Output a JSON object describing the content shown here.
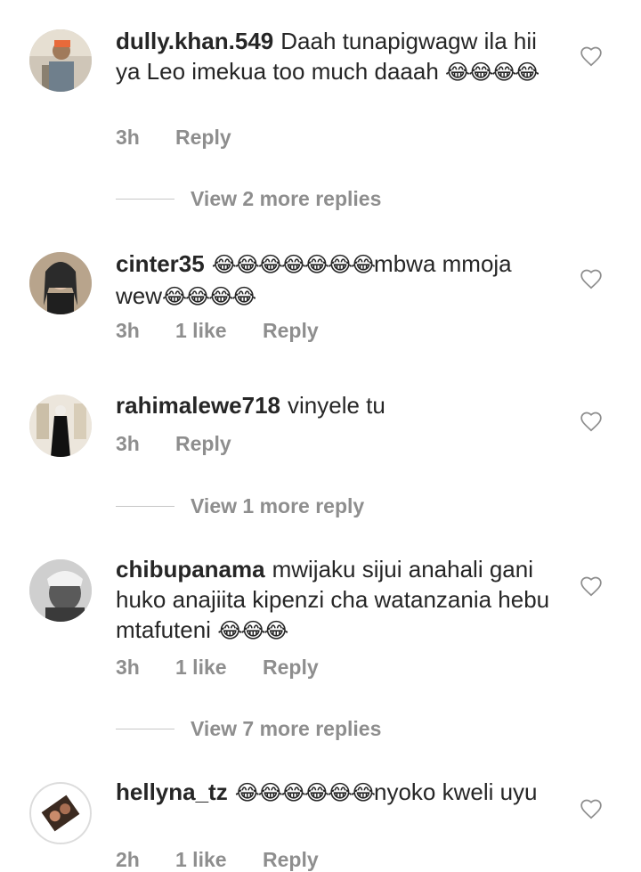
{
  "comments": [
    {
      "username": "dully.khan.549",
      "text": "Daah tunapigwagw ila hii ya Leo imekua too much daaah",
      "emoji": "😂😂😂😂",
      "time": "3h",
      "likes": "",
      "reply": "Reply"
    },
    {
      "username": "cinter35",
      "text_before": "",
      "emoji_lead": "😂😂😂😂😂😂😂",
      "text": "mbwa mmoja wew",
      "emoji": "😂😂😂😂",
      "time": "3h",
      "likes": "1 like",
      "reply": "Reply"
    },
    {
      "username": "rahimalewe718",
      "text": "vinyele tu",
      "emoji": "",
      "time": "3h",
      "likes": "",
      "reply": "Reply"
    },
    {
      "username": "chibupanama",
      "text": "mwijaku sijui anahali gani huko anajiita kipenzi cha watanzania hebu mtafuteni",
      "emoji": "😂😂😂",
      "time": "3h",
      "likes": "1 like",
      "reply": "Reply"
    },
    {
      "username": "hellyna_tz",
      "emoji_lead": "😂😂😂😂😂😂",
      "text": "nyoko kweli uyu",
      "emoji": "",
      "time": "2h",
      "likes": "1 like",
      "reply": "Reply"
    }
  ],
  "view_replies": [
    {
      "label": "View 2 more replies"
    },
    {
      "label": "View 1 more reply"
    },
    {
      "label": "View 7 more replies"
    }
  ],
  "icons": {
    "heart": "heart-outline-icon"
  },
  "colors": {
    "text": "#262626",
    "meta": "#8e8e8e",
    "divider": "#c7c7c7"
  }
}
